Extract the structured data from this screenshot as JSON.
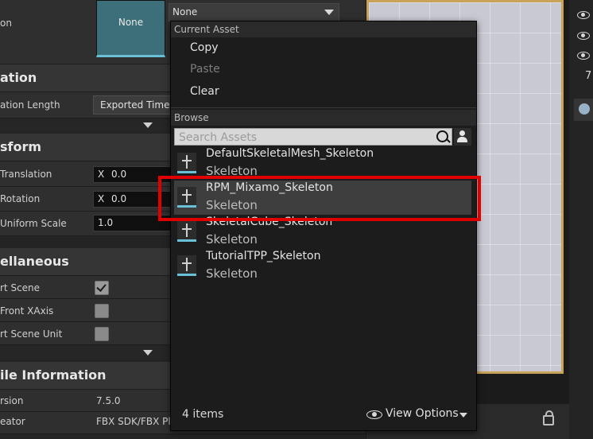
{
  "details": {
    "thumbnail_label": "None",
    "combo_value": "None",
    "rows": {
      "import_animation": "on",
      "animation_length": "ation Length",
      "animation_length_value": "Exported Time",
      "translation": "Translation",
      "rotation": "Rotation",
      "uniform_scale": "Uniform Scale",
      "convert_scene": "rt Scene",
      "force_front": "Front XAxis",
      "convert_unit": "rt Scene Unit",
      "version": "rsion",
      "version_value": "7.5.0",
      "creator": "eator",
      "creator_value": "FBX SDK/FBX Pl"
    },
    "sections": {
      "animation": "ation",
      "transform": "sform",
      "misc": "ellaneous",
      "file_info": "ile Information"
    },
    "translation_axis": "X",
    "translation_x": "0.0",
    "rotation_axis": "X",
    "rotation_x": "0.0",
    "uniform_scale_value": "1.0",
    "convert_scene_checked": true,
    "force_front_checked": false,
    "convert_unit_checked": false
  },
  "right": {
    "count_digit": "7"
  },
  "menu": {
    "current_asset_header": "Current Asset",
    "copy": "Copy",
    "paste": "Paste",
    "clear": "Clear",
    "browse_header": "Browse",
    "search_placeholder": "Search Assets",
    "assets": [
      {
        "name": "DefaultSkeletalMesh_Skeleton",
        "type": "Skeleton"
      },
      {
        "name": "RPM_Mixamo_Skeleton",
        "type": "Skeleton"
      },
      {
        "name": "SkeletalCube_Skeleton",
        "type": "Skeleton"
      },
      {
        "name": "TutorialTPP_Skeleton",
        "type": "Skeleton"
      }
    ],
    "item_count": "4 items",
    "view_options": "View Options"
  },
  "colors": {
    "accent": "#69c0d6",
    "highlight": "#e00000",
    "viewport_border": "#c9a35a"
  }
}
